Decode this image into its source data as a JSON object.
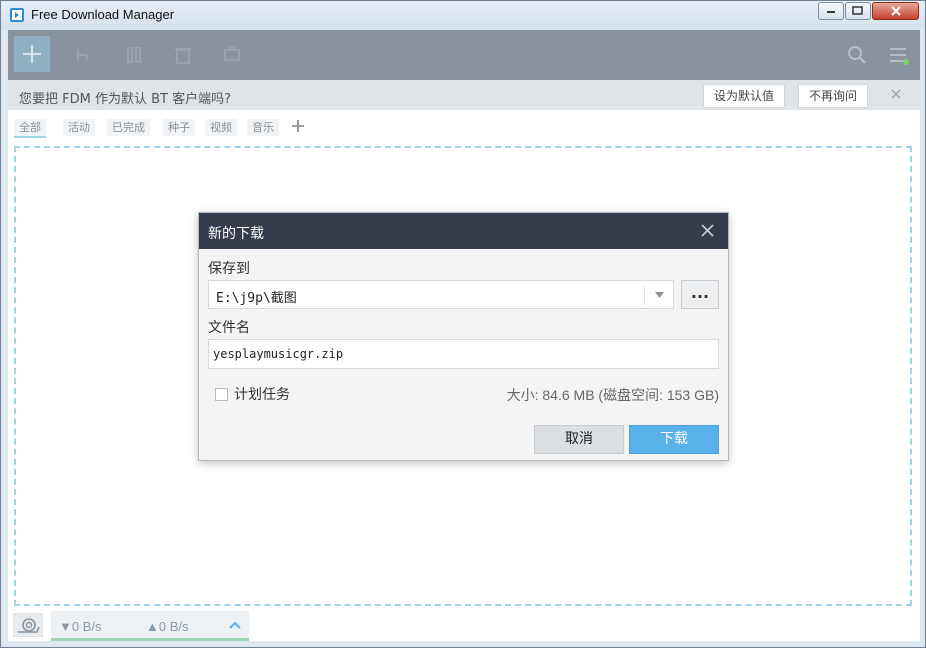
{
  "window": {
    "title": "Free Download Manager"
  },
  "notice": {
    "text": "您要把 FDM 作为默认 BT 客户端吗?",
    "set_default_label": "设为默认值",
    "dont_ask_label": "不再询问"
  },
  "filters": {
    "items": [
      "全部",
      "活动",
      "已完成",
      "种子",
      "视频",
      "音乐"
    ]
  },
  "status": {
    "download_speed": "▼0 B/s",
    "upload_speed": "▲0 B/s"
  },
  "dialog": {
    "title": "新的下载",
    "save_to_label": "保存到",
    "save_path": "E:\\j9p\\截图",
    "browse_label": "...",
    "filename_label": "文件名",
    "filename_value": "yesplaymusicgr.zip",
    "schedule_label": "计划任务",
    "size_text": "大小: 84.6 MB (磁盘空间: 153 GB)",
    "cancel_label": "取消",
    "download_label": "下载"
  },
  "colors": {
    "toolbar_bg": "#8a939d",
    "dialog_header": "#353c4b",
    "primary_button": "#59b1ea",
    "dropzone_border": "#a4d1e2"
  },
  "icons": {
    "add": "plus-icon",
    "open_folder": "folder-icon",
    "pause": "pause-icon",
    "delete": "trash-icon",
    "tag": "tag-icon",
    "search": "search-icon",
    "menu": "hamburger-menu-icon",
    "snail": "snail-icon",
    "close": "close-icon"
  }
}
